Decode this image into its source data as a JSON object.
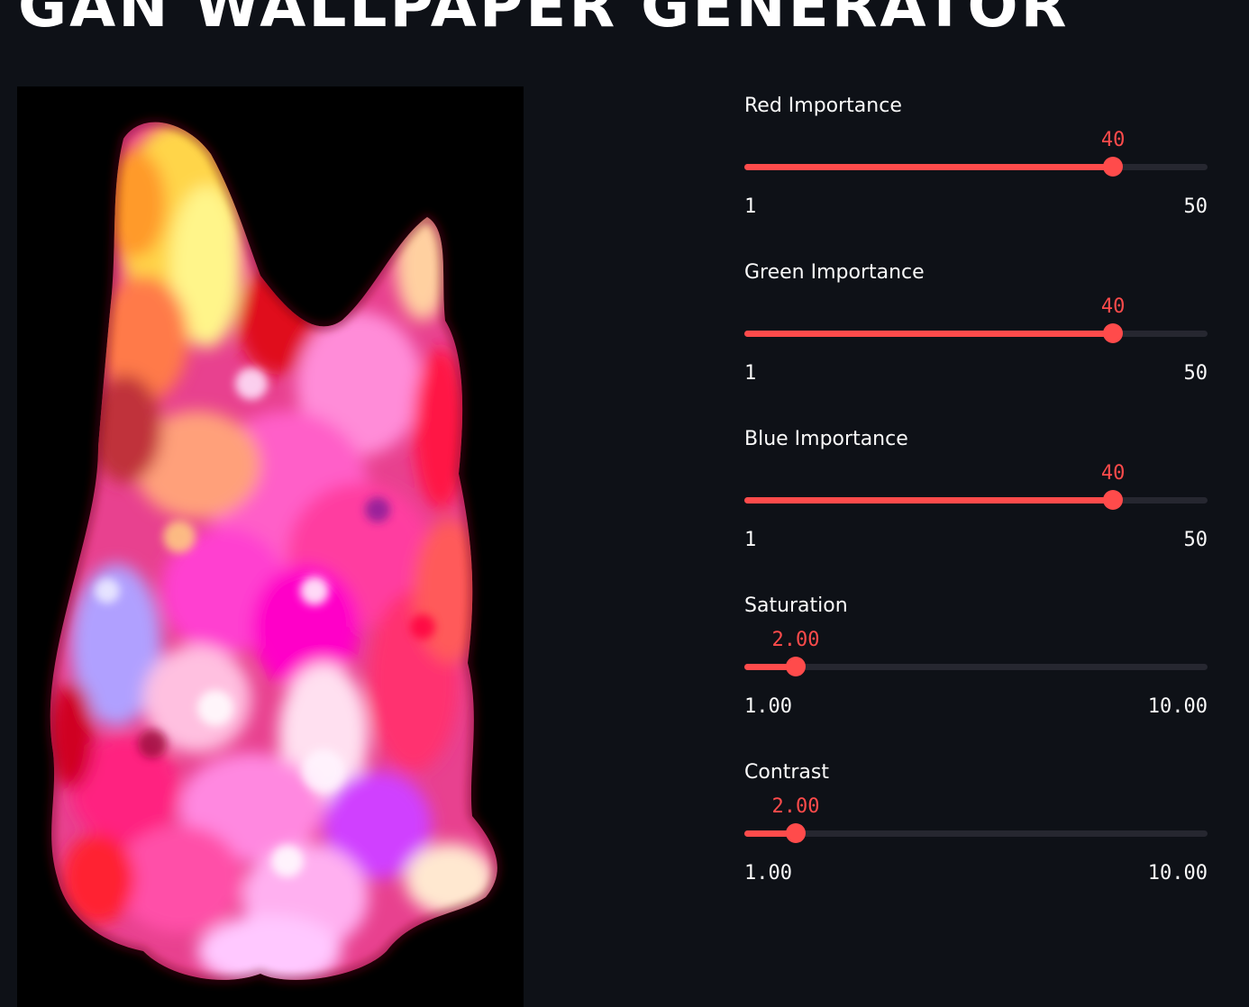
{
  "app": {
    "title": "GAN WALLPAPER GENERATOR"
  },
  "colors": {
    "background": "#0e1117",
    "accent": "#ff4b4b",
    "track": "#262730",
    "text": "#fafafa"
  },
  "sliders": [
    {
      "label": "Red Importance",
      "value": "40",
      "min": "1",
      "max": "50",
      "fraction": 0.796
    },
    {
      "label": "Green Importance",
      "value": "40",
      "min": "1",
      "max": "50",
      "fraction": 0.796
    },
    {
      "label": "Blue Importance",
      "value": "40",
      "min": "1",
      "max": "50",
      "fraction": 0.796
    },
    {
      "label": "Saturation",
      "value": "2.00",
      "min": "1.00",
      "max": "10.00",
      "fraction": 0.111
    },
    {
      "label": "Contrast",
      "value": "2.00",
      "min": "1.00",
      "max": "10.00",
      "fraction": 0.111
    }
  ]
}
